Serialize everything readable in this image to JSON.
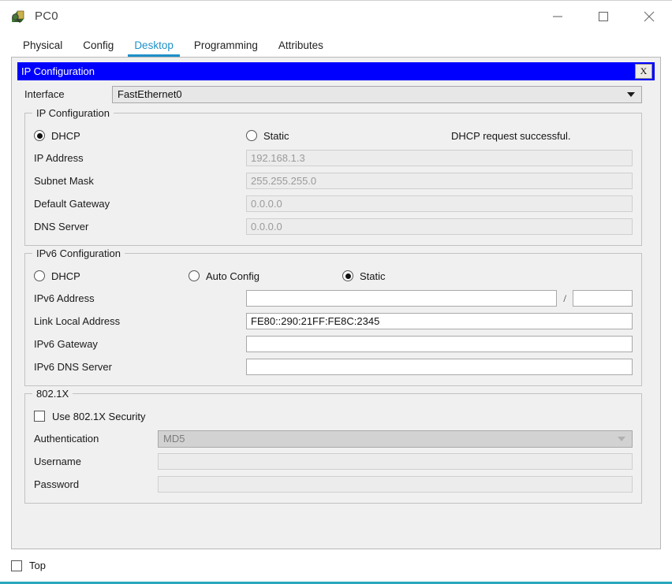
{
  "window": {
    "title": "PC0",
    "icon": "pc-device-icon",
    "controls": [
      {
        "name": "minimize",
        "glyph": "minimize-icon"
      },
      {
        "name": "maximize",
        "glyph": "maximize-icon"
      },
      {
        "name": "close",
        "glyph": "close-icon"
      }
    ]
  },
  "tabs": [
    {
      "label": "Physical",
      "active": false
    },
    {
      "label": "Config",
      "active": false
    },
    {
      "label": "Desktop",
      "active": true
    },
    {
      "label": "Programming",
      "active": false
    },
    {
      "label": "Attributes",
      "active": false
    }
  ],
  "ip_window": {
    "title": "IP Configuration",
    "close_label": "X",
    "accent_color": "#0000ff",
    "tab_accent_color": "#1e90c8"
  },
  "interface": {
    "label": "Interface",
    "value": "FastEthernet0"
  },
  "ipv4": {
    "legend": "IP Configuration",
    "mode_dhcp": "DHCP",
    "mode_static": "Static",
    "selected_mode": "DHCP",
    "status": "DHCP request successful.",
    "fields": [
      {
        "label": "IP Address",
        "value": "192.168.1.3",
        "disabled": true
      },
      {
        "label": "Subnet Mask",
        "value": "255.255.255.0",
        "disabled": true
      },
      {
        "label": "Default Gateway",
        "value": "0.0.0.0",
        "disabled": true
      },
      {
        "label": "DNS Server",
        "value": "0.0.0.0",
        "disabled": true
      }
    ]
  },
  "ipv6": {
    "legend": "IPv6 Configuration",
    "mode_dhcp": "DHCP",
    "mode_auto": "Auto Config",
    "mode_static": "Static",
    "selected_mode": "Static",
    "address_label": "IPv6 Address",
    "address_value": "",
    "prefix_separator": "/",
    "prefix_value": "",
    "fields": [
      {
        "label": "Link Local Address",
        "value": "FE80::290:21FF:FE8C:2345"
      },
      {
        "label": "IPv6 Gateway",
        "value": ""
      },
      {
        "label": "IPv6 DNS Server",
        "value": ""
      }
    ]
  },
  "dot1x": {
    "legend": "802.1X",
    "use_security_label": "Use 802.1X Security",
    "use_security_checked": false,
    "authentication_label": "Authentication",
    "authentication_value": "MD5",
    "username_label": "Username",
    "username_value": "",
    "password_label": "Password",
    "password_value": ""
  },
  "bottom": {
    "top_label": "Top",
    "top_checked": false
  }
}
